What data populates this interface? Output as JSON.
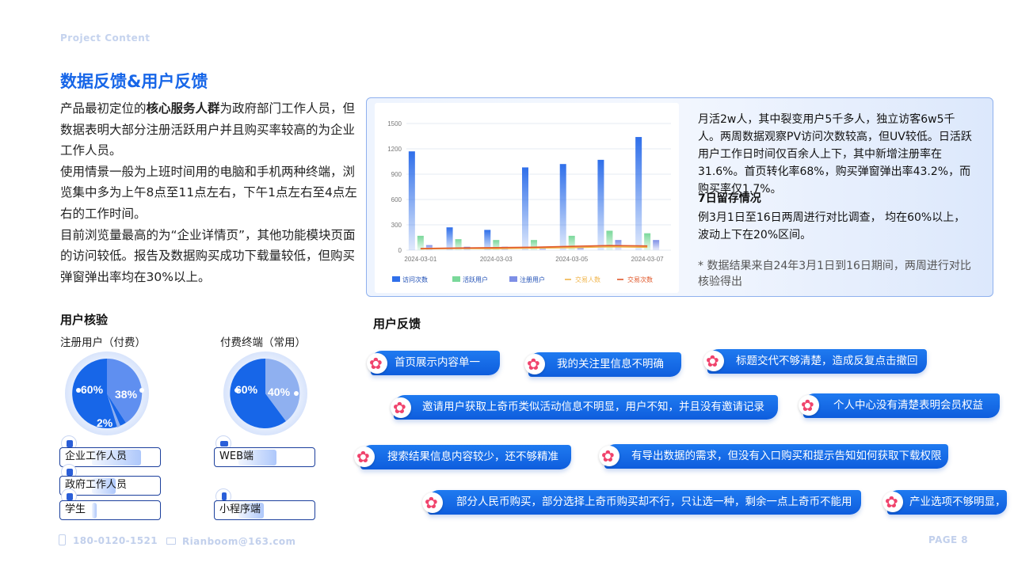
{
  "header": {
    "project_label": "Project Content",
    "title": "数据反馈&用户反馈"
  },
  "intro": {
    "p1_pre": "产品最初定位的",
    "p1_bold": "核心服务人群",
    "p1_post": "为政府部门工作人员，但数据表明大部分注册活跃用户并且购买率较高的为企业工作人员。",
    "p2": "使用情景一般为上班时间用的电脑和手机两种终端，浏览集中多为上午8点至11点左右，下午1点左右至4点左右的工作时间。",
    "p3": "目前浏览量最高的为“企业详情页”，其他功能模块页面的访问较低。报告及数据购买成功下载量较低，但购买弹窗弹出率均在30%以上。"
  },
  "verify": {
    "heading": "用户核验",
    "registered": {
      "label": "注册用户（付费）",
      "pct_a": "60%",
      "pct_b": "38%",
      "pct_c": "2%",
      "share": [
        60,
        38,
        2
      ],
      "legend": [
        "企业工作人员",
        "政府工作人员",
        "学生"
      ],
      "legend_fill": [
        0.78,
        0.38,
        0.06
      ]
    },
    "terminal": {
      "label": "付费终端（常用）",
      "pct_a": "60%",
      "pct_b": "40%",
      "share": [
        60,
        40
      ],
      "legend": [
        "WEB端",
        "小程序端"
      ],
      "legend_fill": [
        0.6,
        0.4
      ]
    },
    "colors": {
      "primary": "#1766e8",
      "secondary": "#8fb0f0",
      "tertiary": "#5f86e6"
    }
  },
  "chart_data": {
    "type": "bar",
    "x": [
      "2024-03-01",
      "2024-03-02",
      "2024-03-03",
      "2024-03-04",
      "2024-03-05",
      "2024-03-06",
      "2024-03-07"
    ],
    "x_tick_labels": [
      "2024-03-01",
      "2024-03-03",
      "2024-03-05",
      "2024-03-07"
    ],
    "y_ticks": [
      0,
      300,
      600,
      900,
      1200,
      1500
    ],
    "ylim": [
      0,
      1500
    ],
    "grid": true,
    "legend_position": "bottom",
    "series": [
      {
        "name": "访问次数",
        "kind": "bar",
        "color": "#2f6fea",
        "values": [
          1170,
          270,
          240,
          980,
          1020,
          1070,
          1340
        ]
      },
      {
        "name": "活跃用户",
        "kind": "bar",
        "color": "#7ad89a",
        "values": [
          170,
          130,
          120,
          120,
          170,
          230,
          200
        ]
      },
      {
        "name": "注册用户",
        "kind": "bar",
        "color": "#7e8fe6",
        "values": [
          60,
          40,
          40,
          30,
          30,
          120,
          120
        ]
      },
      {
        "name": "交易人数",
        "kind": "line",
        "color": "#f0b44a",
        "values": [
          15,
          20,
          18,
          25,
          30,
          40,
          35
        ]
      },
      {
        "name": "交易次数",
        "kind": "line",
        "color": "#e0582b",
        "values": [
          20,
          25,
          30,
          35,
          45,
          55,
          50
        ]
      }
    ]
  },
  "panel": {
    "text1": "月活2w人，其中裂变用户5千多人，独立访客6w5千人。两周数据观察PV访问次数较高，但UV较低。日活跃用户工作日时间仅百余人上下，其中新增注册率在31.6%。首页转化率68%，购买弹窗弹出率43.2%，而购买率仅1.7%。",
    "sub": "7日留存情况",
    "text2": "例3月1日至16日两周进行对比调查， 均在60%以上，波动上下在20%区间。",
    "note": "* 数据结果来自24年3月1日到16日期间，两周进行对比核验得出"
  },
  "feedback": {
    "heading": "用户反馈",
    "items": [
      "首页展示内容单一",
      "我的关注里信息不明确",
      "标题交代不够清楚，造成反复点击撤回",
      "邀请用户获取上奇币类似活动信息不明显，用户不知，并且没有邀请记录",
      "个人中心没有清楚表明会员权益",
      "搜索结果信息内容较少，还不够精准",
      "有导出数据的需求，但没有入口购买和提示告知如何获取下载权限",
      "部分人民币购买，部分选择上奇币购买却不行，只让选一种，剩余一点上奇币不能用",
      "产业选项不够明显，"
    ]
  },
  "footer": {
    "phone": "180-0120-1521",
    "email": "Rianboom@163.com",
    "page": "PAGE 8"
  }
}
